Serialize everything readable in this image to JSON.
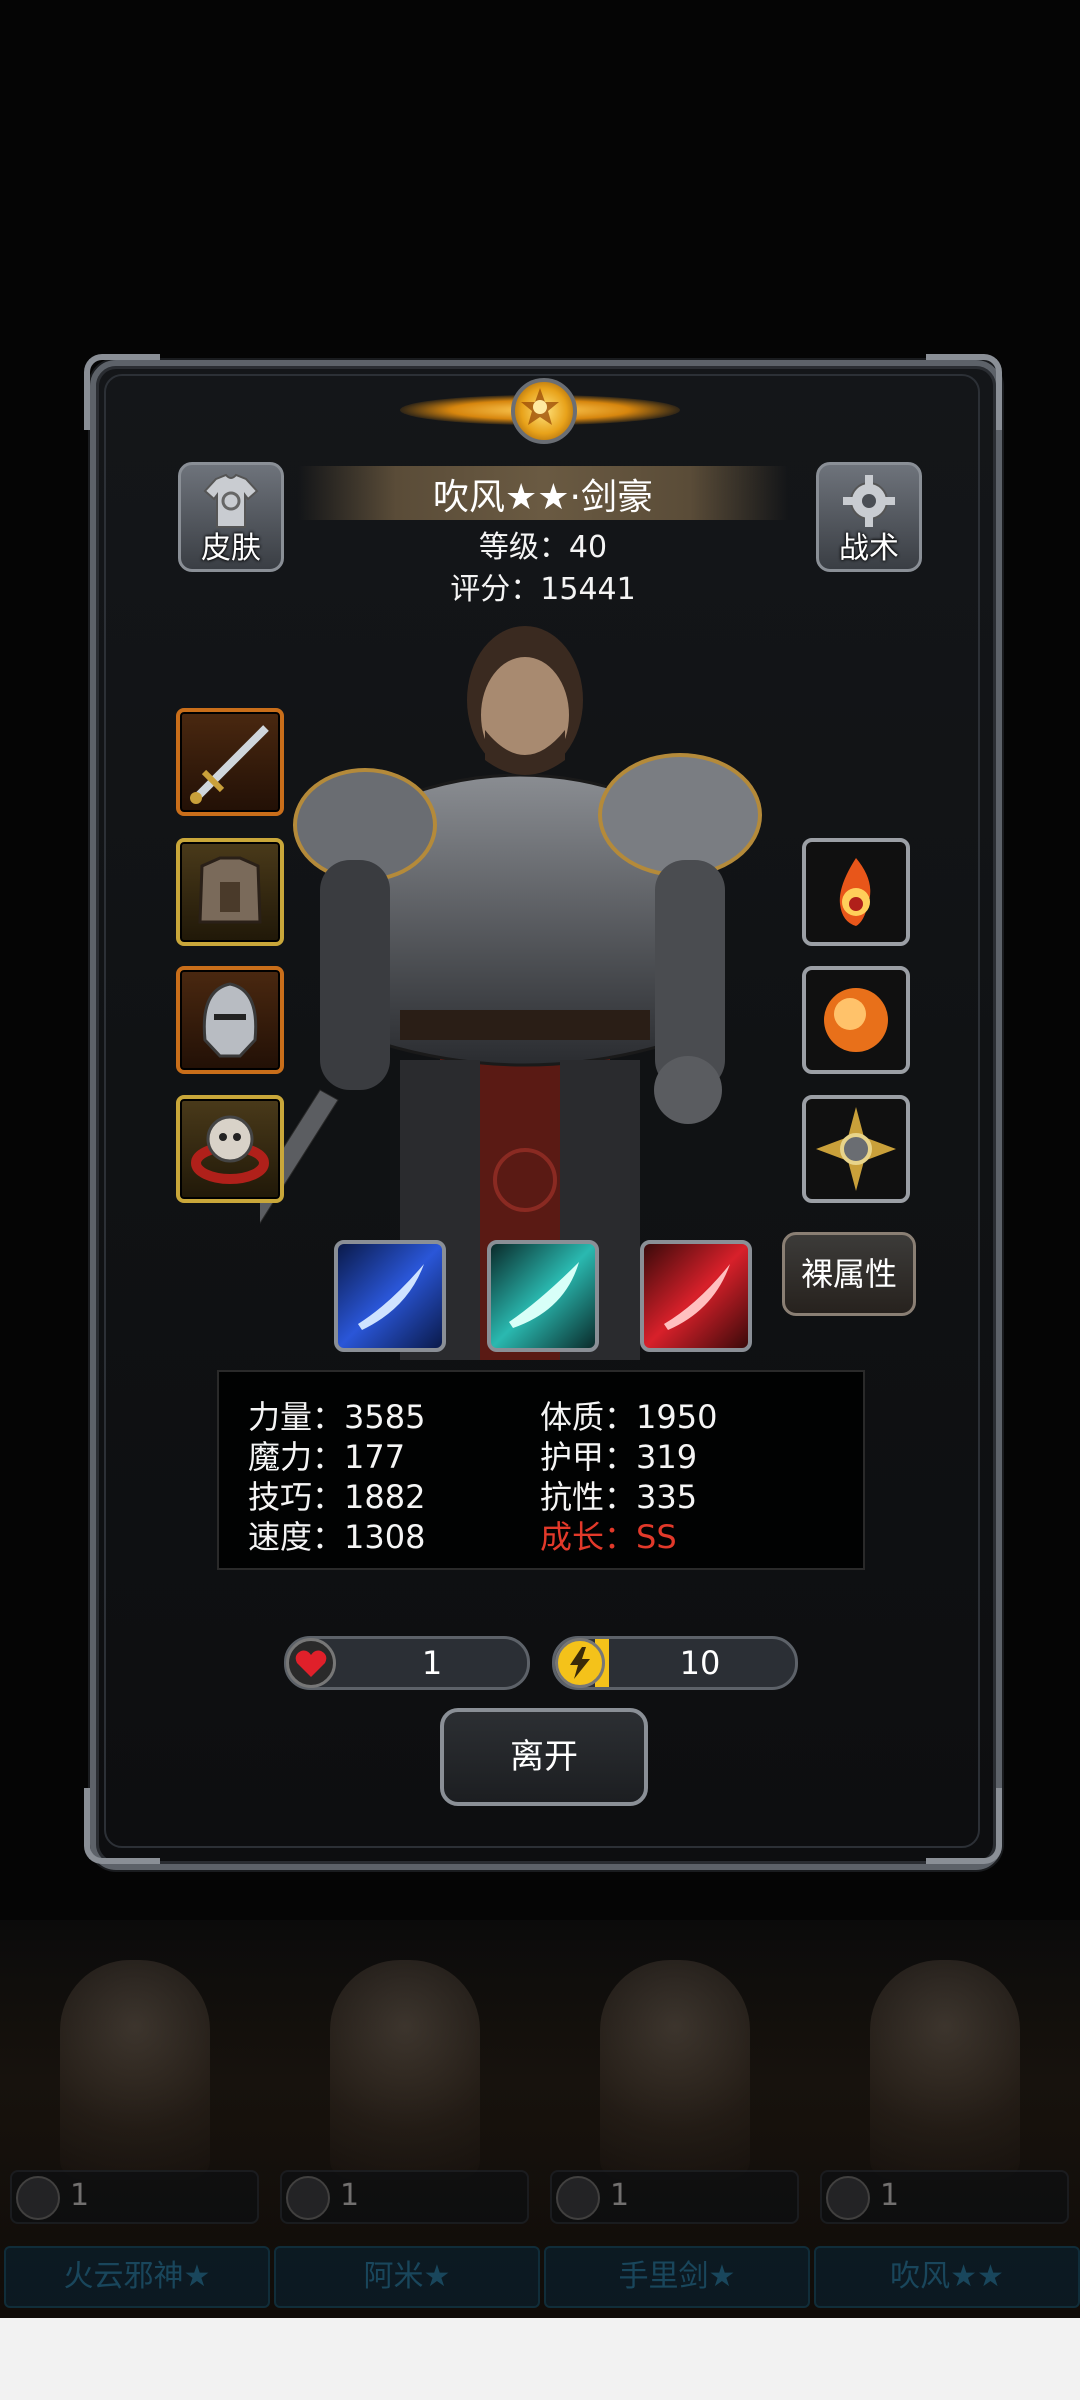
{
  "hero": {
    "name": "吹风★★·剑豪",
    "level_text": "等级：40",
    "score_text": "评分：15441"
  },
  "buttons": {
    "skin": "皮肤",
    "tactics": "战术",
    "naked_attr": "裸属性",
    "leave": "离开"
  },
  "equipment_left": [
    {
      "icon": "sword-icon"
    },
    {
      "icon": "armor-icon"
    },
    {
      "icon": "helmet-icon"
    },
    {
      "icon": "ring-icon"
    }
  ],
  "equipment_right": [
    {
      "icon": "fire-rune-icon"
    },
    {
      "icon": "fire-orb-icon"
    },
    {
      "icon": "sun-amulet-icon"
    }
  ],
  "skills": [
    {
      "icon": "blue-slash-icon",
      "color": "#3b63d8"
    },
    {
      "icon": "cyan-slash-icon",
      "color": "#2aa9a9"
    },
    {
      "icon": "red-slash-icon",
      "color": "#c8202a"
    }
  ],
  "stats": {
    "left": [
      "力量：3585",
      "魔力：177",
      "技巧：1882",
      "速度：1308"
    ],
    "right": [
      "体质：1950",
      "护甲：319",
      "抗性：335"
    ],
    "growth": "成长：SS",
    "growth_color": "#e2392a"
  },
  "resources": {
    "hearts": "1",
    "energy": "10"
  },
  "roster": [
    {
      "name": "火云邪神★",
      "count": "1"
    },
    {
      "name": "阿米★",
      "count": "1"
    },
    {
      "name": "手里剑★",
      "count": "1"
    },
    {
      "name": "吹风★★",
      "count": "1"
    }
  ]
}
